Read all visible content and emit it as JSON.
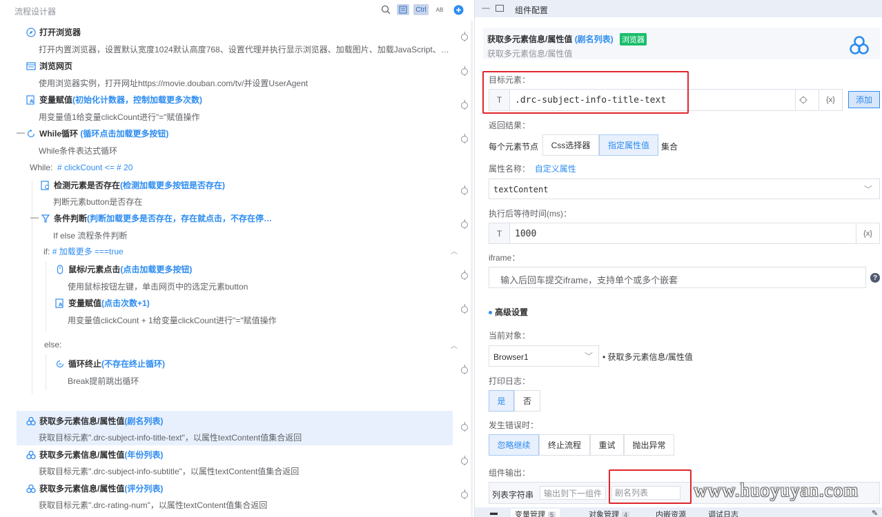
{
  "left": {
    "title": "流程设计器",
    "toolbar": {
      "ctrl_label": "Ctrl",
      "ab_label": "AB"
    },
    "nodes": [
      {
        "title": "打开浏览器",
        "paren": "",
        "desc": "打开内置浏览器，设置默认宽度1024默认高度768、设置代理并执行显示浏览器、加载图片、加载JavaScript、…",
        "icon": "compass-icon"
      },
      {
        "title": "浏览网页",
        "paren": "",
        "desc": "使用浏览器实例，打开网址https://movie.douban.com/tv/并设置UserAgent",
        "icon": "browser-window-icon"
      },
      {
        "title": "变量赋值",
        "paren": "(初始化计数器，控制加载更多次数)",
        "desc": "用变量值1给变量clickCount进行\"=\"赋值操作",
        "icon": "variable-icon"
      },
      {
        "title": "While循环",
        "paren": "(循环点击加载更多按钮)",
        "desc": "While条件表达式循环",
        "icon": "loop-icon"
      },
      {
        "title": "检测元素是否存在",
        "paren": "(检测加载更多按钮是否存在)",
        "desc": "判断元素button是否存在",
        "icon": "detect-element-icon"
      },
      {
        "title": "条件判断",
        "paren": "(判断加载更多是否存在，存在就点击，不存在停…",
        "desc": "If else 流程条件判断",
        "icon": "condition-icon"
      },
      {
        "title": "鼠标/元素点击",
        "paren": "(点击加载更多按钮)",
        "desc": "使用鼠标按钮左键，单击网页中的选定元素button",
        "icon": "mouse-icon"
      },
      {
        "title": "变量赋值",
        "paren": "(点击次数+1)",
        "desc": "用变量值clickCount + 1给变量clickCount进行\"=\"赋值操作",
        "icon": "variable-icon"
      },
      {
        "title": "循环终止",
        "paren": "(不存在终止循环)",
        "desc": "Break提前跳出循环",
        "icon": "loop-break-icon"
      },
      {
        "title": "获取多元素信息/属性值",
        "paren": "(剧名列表)",
        "desc": "获取目标元素\".drc-subject-info-title-text\"，以属性textContent值集合返回",
        "icon": "multi-element-icon"
      },
      {
        "title": "获取多元素信息/属性值",
        "paren": "(年份列表)",
        "desc": "获取目标元素\".drc-subject-info-subtitle\"，以属性textContent值集合返回",
        "icon": "multi-element-icon"
      },
      {
        "title": "获取多元素信息/属性值",
        "paren": "(评分列表)",
        "desc": "获取目标元素\".drc-rating-num\"，以属性textContent值集合返回",
        "icon": "multi-element-icon"
      }
    ],
    "while_label": "While:",
    "while_expr": "# clickCount <= # 20",
    "if_label": "if:",
    "if_expr": "# 加载更多 ===true",
    "else_label": "else:"
  },
  "right": {
    "header_title": "组件配置",
    "info": {
      "title": "获取多元素信息/属性值",
      "paren": "(剧名列表)",
      "badge": "浏览器",
      "subtitle": "获取多元素信息/属性值"
    },
    "target": {
      "label": "目标元素：",
      "prefix": "T",
      "value": ".drc-subject-info-title-text",
      "fx": "{x}",
      "add_button": "添加"
    },
    "result": {
      "label": "返回结果：",
      "each_node": "每个元素节点",
      "options": [
        "Css选择器",
        "指定属性值"
      ],
      "selected": "指定属性值",
      "suffix": "集合"
    },
    "attr": {
      "label": "属性名称：",
      "custom_link": "自定义属性",
      "value": "textContent"
    },
    "wait": {
      "label": "执行后等待时间(ms)：",
      "prefix": "T",
      "value": "1000",
      "fx": "{x}"
    },
    "iframe": {
      "label": "iframe：",
      "placeholder": "输入后回车提交iframe，支持单个或多个嵌套"
    },
    "advanced": {
      "label": "高级设置"
    },
    "current": {
      "label": "当前对象：",
      "value": "Browser1",
      "note": "获取多元素信息/属性值"
    },
    "log": {
      "label": "打印日志：",
      "options": [
        "是",
        "否"
      ],
      "selected": "是"
    },
    "on_error": {
      "label": "发生错误时：",
      "options": [
        "忽略继续",
        "终止流程",
        "重试",
        "抛出异常"
      ],
      "selected": "忽略继续"
    },
    "output": {
      "label": "组件输出：",
      "type": "列表字符串",
      "to_next": "输出到下一组件",
      "value": "剧名列表"
    },
    "bottom_tabs": [
      {
        "label": "变量管理",
        "count": "5"
      },
      {
        "label": "对象管理",
        "count": "4"
      },
      {
        "label": "内嵌资源",
        "count": ""
      },
      {
        "label": "调试日志",
        "count": ""
      }
    ]
  },
  "watermark": "www.huoyuyan.com",
  "colors": {
    "accent": "#2d8cf0",
    "badge": "#19be6b",
    "highlight": "#e0242b",
    "selected_row": "#e8f0fd"
  }
}
